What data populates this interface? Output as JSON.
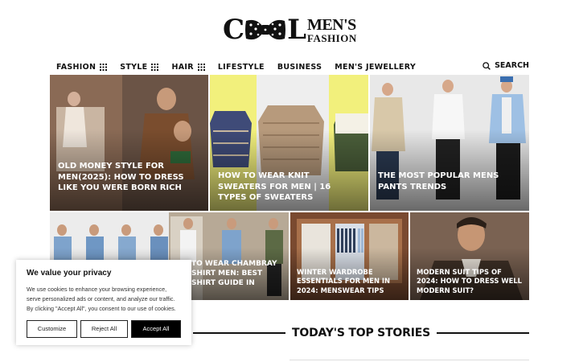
{
  "logo": {
    "part1": "C",
    "part2": "L",
    "line1": "MEN'S",
    "line2": "FASHION"
  },
  "nav": {
    "items": [
      {
        "label": "FASHION",
        "has_menu": true
      },
      {
        "label": "STYLE",
        "has_menu": true
      },
      {
        "label": "HAIR",
        "has_menu": true
      },
      {
        "label": "LIFESTYLE",
        "has_menu": false
      },
      {
        "label": "BUSINESS",
        "has_menu": false
      },
      {
        "label": "MEN'S JEWELLERY",
        "has_menu": false
      }
    ],
    "search_label": "SEARCH"
  },
  "featured": [
    {
      "title": "OLD MONEY STYLE FOR MEN(2025): HOW TO DRESS LIKE YOU WERE BORN RICH"
    },
    {
      "title": "HOW TO WEAR KNIT SWEATERS FOR MEN | 16 TYPES OF SWEATERS"
    },
    {
      "title": "THE MOST POPULAR MENS PANTS TRENDS"
    }
  ],
  "secondary": [
    {
      "title": "TO WEAR CHAMBRAY SHIRT MEN: BEST SHIRT GUIDE IN"
    },
    {
      "title": "WINTER WARDROBE ESSENTIALS FOR MEN IN 2024: MENSWEAR TIPS"
    },
    {
      "title": "MODERN SUIT TIPS OF 2024: HOW TO DRESS WELL MODERN SUIT?"
    }
  ],
  "cookie": {
    "title": "We value your privacy",
    "text": "We use cookies to enhance your browsing experience, serve personalized ads or content, and analyze our traffic. By clicking \"Accept All\", you consent to our use of cookies.",
    "customize": "Customize",
    "reject": "Reject All",
    "accept": "Accept All"
  },
  "section_heading": "TODAY'S TOP STORIES"
}
